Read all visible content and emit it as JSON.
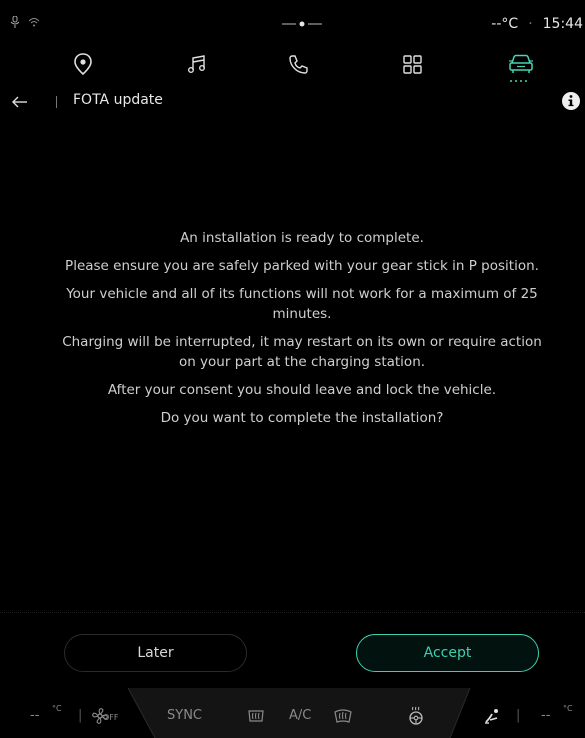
{
  "status": {
    "temperature": "--°C",
    "separator": "·",
    "time": "15:44"
  },
  "nav": {
    "items": [
      {
        "icon": "location-pin-icon"
      },
      {
        "icon": "music-note-icon"
      },
      {
        "icon": "phone-icon"
      },
      {
        "icon": "apps-grid-icon"
      },
      {
        "icon": "car-icon",
        "active": true
      }
    ],
    "accent_color": "#46d6b4"
  },
  "header": {
    "title": "FOTA update"
  },
  "message": {
    "lines": [
      "An installation is ready to complete.",
      "Please ensure you are safely parked with your gear stick in P position.",
      "Your vehicle and all of its functions will not work for a maximum of 25 minutes.",
      "Charging will be interrupted, it may restart on its own or require action on your part at the charging station.",
      "After your consent you should leave and lock the vehicle.",
      "Do you want to complete the installation?"
    ]
  },
  "buttons": {
    "later": "Later",
    "accept": "Accept"
  },
  "climate": {
    "left_temp": "--",
    "left_unit": "°C",
    "fan_label": "OFF",
    "sync": "SYNC",
    "ac": "A/C",
    "right_temp": "--",
    "right_unit": "°C"
  }
}
